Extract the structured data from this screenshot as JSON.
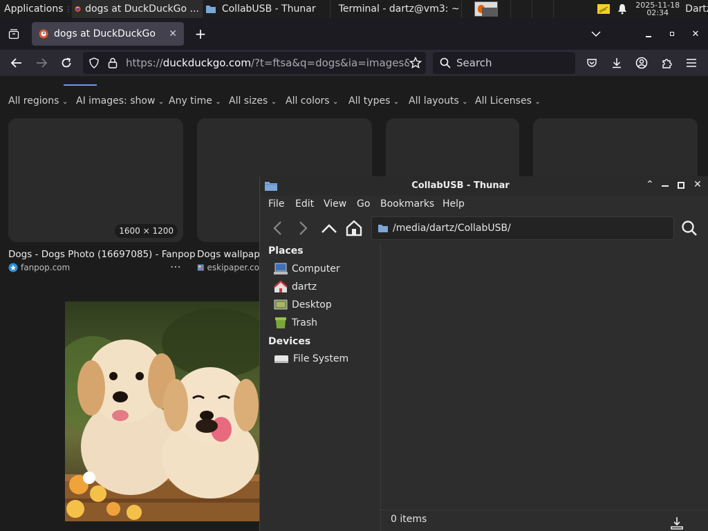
{
  "taskbar": {
    "apps_label": "Applications",
    "windows": [
      {
        "label": "dogs at DuckDuckGo ..."
      },
      {
        "label": "CollabUSB - Thunar"
      },
      {
        "label": "Terminal - dartz@vm3: ~"
      }
    ],
    "clock": {
      "date": "2025-11-18",
      "time": "02:34"
    },
    "user": "Dartz"
  },
  "firefox": {
    "tab_title": "dogs at DuckDuckGo",
    "url_prefix": "https://",
    "url_domain": "duckduckgo.com",
    "url_rest": "/?t=ftsa&q=dogs&ia=images&ia=",
    "search_placeholder": "Search"
  },
  "ddg": {
    "filters": [
      {
        "label": "All regions"
      },
      {
        "label": "AI images: show"
      },
      {
        "label": "Any time"
      },
      {
        "label": "All sizes"
      },
      {
        "label": "All colors"
      },
      {
        "label": "All types"
      },
      {
        "label": "All layouts"
      },
      {
        "label": "All Licenses"
      }
    ],
    "results": [
      {
        "size": "1600 × 1200",
        "title": "Dogs - Dogs Photo (16697085) - Fanpop",
        "source": "fanpop.com"
      },
      {
        "title": "Dogs wallpaper",
        "source": "eskipaper.co"
      }
    ]
  },
  "thunar": {
    "title": "CollabUSB - Thunar",
    "menus": [
      "File",
      "Edit",
      "View",
      "Go",
      "Bookmarks",
      "Help"
    ],
    "location": "/media/dartz/CollabUSB/",
    "places_heading": "Places",
    "places": [
      {
        "label": "Computer",
        "icon": "computer-icon"
      },
      {
        "label": "dartz",
        "icon": "home-folder-icon"
      },
      {
        "label": "Desktop",
        "icon": "desktop-icon"
      },
      {
        "label": "Trash",
        "icon": "trash-icon"
      }
    ],
    "devices_heading": "Devices",
    "devices": [
      {
        "label": "File System",
        "icon": "drive-icon"
      }
    ],
    "status": "0 items"
  },
  "colors": {
    "ddg_accent": "#7295f6",
    "firefox_bg": "#1c1b22",
    "thunar_bg": "#2d2d2d"
  }
}
